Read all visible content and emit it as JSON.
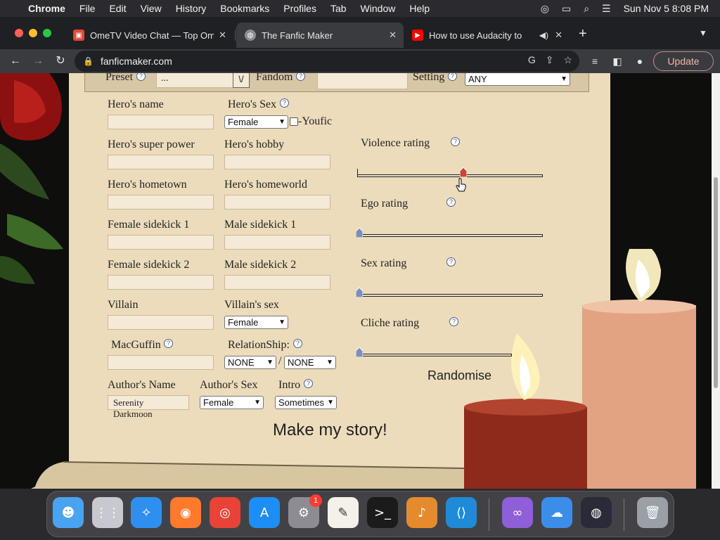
{
  "menubar": {
    "app_name": "Chrome",
    "items": [
      "File",
      "Edit",
      "View",
      "History",
      "Bookmarks",
      "Profiles",
      "Tab",
      "Window",
      "Help"
    ],
    "clock": "Sun Nov 5  8:08 PM"
  },
  "tabs": [
    {
      "title": "OmeTV Video Chat — Top Ome"
    },
    {
      "title": "The Fanfic Maker"
    },
    {
      "title": "How to use Audacity to"
    }
  ],
  "toolbar": {
    "url": "fanficmaker.com",
    "update_label": "Update"
  },
  "form": {
    "preset_label": "Preset",
    "preset_value": "...",
    "preset_button": "\\/",
    "fandom_label": "Fandom",
    "setting_label": "Setting",
    "setting_value": "ANY",
    "hero_name_label": "Hero's name",
    "hero_sex_label": "Hero's Sex",
    "hero_sex_value": "Female",
    "youfic_label": "-Youfic",
    "super_power_label": "Hero's super power",
    "hobby_label": "Hero's hobby",
    "hometown_label": "Hero's hometown",
    "homeworld_label": "Hero's homeworld",
    "female_sidekick1_label": "Female sidekick 1",
    "male_sidekick1_label": "Male sidekick 1",
    "female_sidekick2_label": "Female sidekick 2",
    "male_sidekick2_label": "Male sidekick 2",
    "villain_label": "Villain",
    "villain_sex_label": "Villain's sex",
    "villain_sex_value": "Female",
    "macguffin_label": "MacGuffin",
    "relationship_label": "RelationShip:",
    "relationship_value1": "NONE",
    "relationship_sep": "/",
    "relationship_value2": "NONE",
    "author_name_label": "Author's Name",
    "author_name_value": "Serenity Darkmoon",
    "author_sex_label": "Author's Sex",
    "author_sex_value": "Female",
    "intro_label": "Intro",
    "intro_value": "Sometimes",
    "make_story_label": "Make my story!",
    "randomise_label": "Randomise",
    "help_glyph": "?"
  },
  "ratings": [
    {
      "label": "Violence rating",
      "level": 0.56
    },
    {
      "label": "Ego rating",
      "level": 0.0
    },
    {
      "label": "Sex rating",
      "level": 0.0
    },
    {
      "label": "Cliche rating",
      "level": 0.0
    }
  ],
  "dock": {
    "notification_badge": "1",
    "apps": [
      "finder-icon",
      "launchpad-icon",
      "safari-icon",
      "firefox-icon",
      "chrome-icon",
      "app-store-icon",
      "system-settings-icon",
      "textedit-icon",
      "terminal-icon",
      "garageband-icon",
      "vscode-icon",
      "visual-studio-icon",
      "weather-icon",
      "obs-icon",
      "trash-icon"
    ]
  },
  "colors": {
    "parchment": "#ecdcbb",
    "update_accent": "#f4b4ac",
    "slider_thumb": "#7d8fb8",
    "violence_thumb": "#c9453a"
  }
}
